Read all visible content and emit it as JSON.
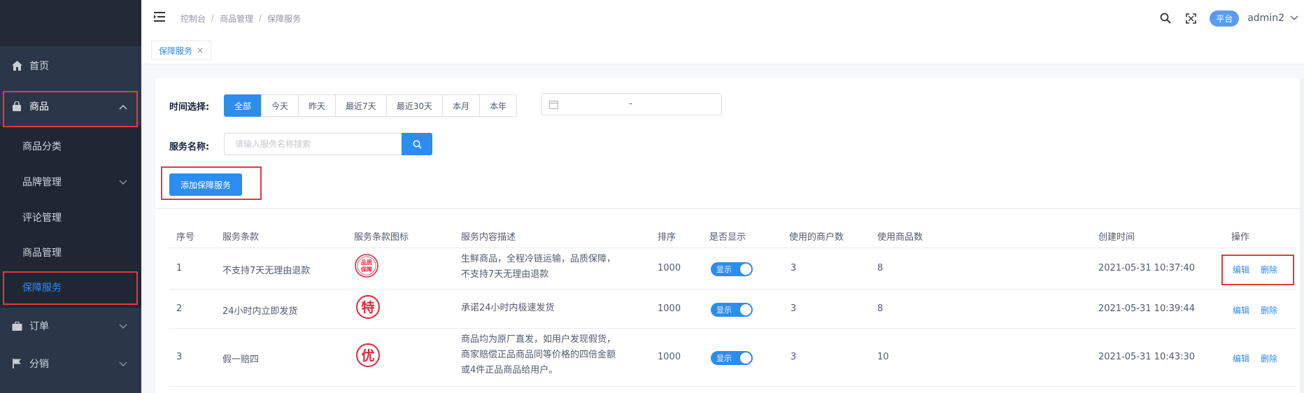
{
  "sidebar": {
    "items": [
      {
        "label": "首页",
        "icon": "home-icon"
      },
      {
        "label": "商品",
        "icon": "bag-icon"
      },
      {
        "label": "订单",
        "icon": "briefcase-icon"
      },
      {
        "label": "分销",
        "icon": "flag-icon"
      }
    ],
    "sub_items": [
      {
        "label": "商品分类"
      },
      {
        "label": "品牌管理"
      },
      {
        "label": "评论管理"
      },
      {
        "label": "商品管理"
      },
      {
        "label": "保障服务"
      }
    ]
  },
  "header": {
    "breadcrumb": [
      "控制台",
      "商品管理",
      "保障服务"
    ],
    "breadcrumb_sep": "/",
    "platform_badge": "平台",
    "username": "admin2"
  },
  "tabs": [
    {
      "label": "保障服务",
      "close": "×"
    }
  ],
  "filters": {
    "time_label": "时间选择:",
    "time_options": [
      "全部",
      "今天",
      "昨天",
      "最近7天",
      "最近30天",
      "本月",
      "本年"
    ],
    "selected_time": "全部",
    "date_separator": "-",
    "name_label": "服务名称:",
    "name_placeholder": "请输入服务名称搜索",
    "name_value": ""
  },
  "add_button": "添加保障服务",
  "table": {
    "columns": [
      "序号",
      "服务条款",
      "服务条款图标",
      "服务内容描述",
      "排序",
      "是否显示",
      "使用的商户数",
      "使用商品数",
      "创建时间",
      "操作"
    ],
    "rows": [
      {
        "id": "1",
        "name": "不支持7天无理由退款",
        "icon_text": [
          "品质",
          "保障"
        ],
        "desc": [
          "生鲜商品，全程冷链运输，品质保障，",
          "不支持7天无理由退款"
        ],
        "sort": "1000",
        "display": "显示",
        "merchants": "3",
        "products": "8",
        "created": "2021-05-31 10:37:40"
      },
      {
        "id": "2",
        "name": "24小时内立即发货",
        "icon_text": [
          "特"
        ],
        "desc": [
          "承诺24小时内极速发货"
        ],
        "sort": "1000",
        "display": "显示",
        "merchants": "3",
        "products": "8",
        "created": "2021-05-31 10:39:44"
      },
      {
        "id": "3",
        "name": "假一赔四",
        "icon_text": [
          "优"
        ],
        "desc": [
          "商品均为原厂直发，如用户发现假货，",
          "商家赔偿正品商品同等价格的四倍金额",
          "或4件正品商品给用户。"
        ],
        "sort": "1000",
        "display": "显示",
        "merchants": "3",
        "products": "10",
        "created": "2021-05-31 10:43:30"
      }
    ],
    "actions": {
      "edit": "编辑",
      "delete": "删除"
    }
  },
  "colors": {
    "sidebar_bg": "#2b3648",
    "accent": "#2d8cf0",
    "highlight_box": "#e23b3b",
    "seal_red": "#e0263b"
  }
}
